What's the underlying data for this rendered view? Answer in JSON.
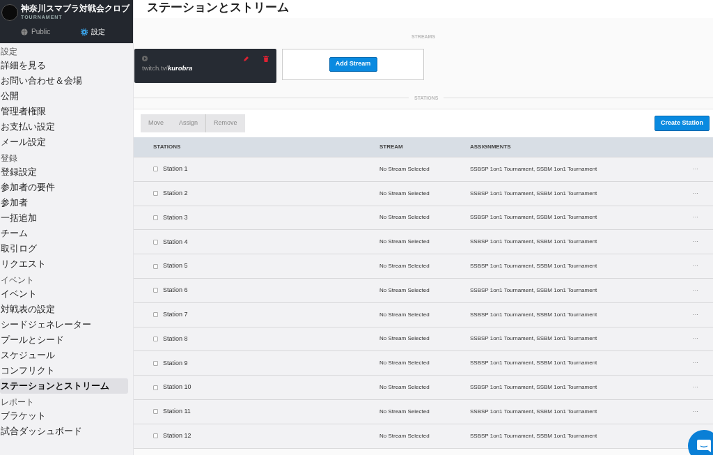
{
  "sidebar": {
    "org_title": "神奈川スマブラ対戦会クロブ",
    "org_subtitle": "TOURNAMENT",
    "header_links": [
      {
        "label": "Public",
        "selected": false
      },
      {
        "label": "設定",
        "selected": true
      }
    ],
    "sections": [
      {
        "heading": "設定",
        "items": [
          {
            "label": "詳細を見る",
            "selected": false
          },
          {
            "label": "お問い合わせ＆会場",
            "selected": false
          },
          {
            "label": "公開",
            "selected": false
          },
          {
            "label": "管理者権限",
            "selected": false
          },
          {
            "label": "お支払い設定",
            "selected": false
          },
          {
            "label": "メール設定",
            "selected": false
          }
        ]
      },
      {
        "heading": "登録",
        "items": [
          {
            "label": "登録設定",
            "selected": false
          },
          {
            "label": "参加者の要件",
            "selected": false
          },
          {
            "label": "参加者",
            "selected": false
          },
          {
            "label": "一括追加",
            "selected": false
          },
          {
            "label": "チーム",
            "selected": false
          },
          {
            "label": "取引ログ",
            "selected": false
          },
          {
            "label": "リクエスト",
            "selected": false
          }
        ]
      },
      {
        "heading": "イベント",
        "items": [
          {
            "label": "イベント",
            "selected": false
          },
          {
            "label": "対戦表の設定",
            "selected": false
          },
          {
            "label": "シードジェネレーター",
            "selected": false
          },
          {
            "label": "プールとシード",
            "selected": false
          },
          {
            "label": "スケジュール",
            "selected": false
          },
          {
            "label": "コンフリクト",
            "selected": false
          },
          {
            "label": "ステーションとストリーム",
            "selected": true
          }
        ]
      },
      {
        "heading": "レポート",
        "items": [
          {
            "label": "ブラケット",
            "selected": false
          },
          {
            "label": "試合ダッシュボード",
            "selected": false
          }
        ]
      }
    ]
  },
  "page_title": "ステーションとストリーム",
  "streams_label": "STREAMS",
  "streams": [
    {
      "prefix": "twitch.tv/",
      "channel": "kurobra"
    }
  ],
  "add_stream_button": "Add Stream",
  "stations_label": "STATIONS",
  "toolbar": {
    "buttons": [
      {
        "label": "Move",
        "disabled": true
      },
      {
        "label": "Assign",
        "disabled": true
      },
      {
        "label": "Remove",
        "disabled": true
      }
    ],
    "create_button": "Create Station"
  },
  "table": {
    "columns": [
      "STATIONS",
      "STREAM",
      "ASSIGNMENTS"
    ],
    "rows": [
      {
        "name": "Station 1",
        "checked": false,
        "stream": "No Stream Selected",
        "assignments": "SSBSP 1on1 Tournament, SSBM 1on1 Tournament",
        "menu": "···"
      },
      {
        "name": "Station 2",
        "checked": false,
        "stream": "No Stream Selected",
        "assignments": "SSBSP 1on1 Tournament, SSBM 1on1 Tournament",
        "menu": "···"
      },
      {
        "name": "Station 3",
        "checked": false,
        "stream": "No Stream Selected",
        "assignments": "SSBSP 1on1 Tournament, SSBM 1on1 Tournament",
        "menu": "···"
      },
      {
        "name": "Station 4",
        "checked": false,
        "stream": "No Stream Selected",
        "assignments": "SSBSP 1on1 Tournament, SSBM 1on1 Tournament",
        "menu": "···"
      },
      {
        "name": "Station 5",
        "checked": false,
        "stream": "No Stream Selected",
        "assignments": "SSBSP 1on1 Tournament, SSBM 1on1 Tournament",
        "menu": "···"
      },
      {
        "name": "Station 6",
        "checked": false,
        "stream": "No Stream Selected",
        "assignments": "SSBSP 1on1 Tournament, SSBM 1on1 Tournament",
        "menu": "···"
      },
      {
        "name": "Station 7",
        "checked": false,
        "stream": "No Stream Selected",
        "assignments": "SSBSP 1on1 Tournament, SSBM 1on1 Tournament",
        "menu": "···"
      },
      {
        "name": "Station 8",
        "checked": false,
        "stream": "No Stream Selected",
        "assignments": "SSBSP 1on1 Tournament, SSBM 1on1 Tournament",
        "menu": "···"
      },
      {
        "name": "Station 9",
        "checked": false,
        "stream": "No Stream Selected",
        "assignments": "SSBSP 1on1 Tournament, SSBM 1on1 Tournament",
        "menu": "···"
      },
      {
        "name": "Station 10",
        "checked": false,
        "stream": "No Stream Selected",
        "assignments": "SSBSP 1on1 Tournament, SSBM 1on1 Tournament",
        "menu": "···"
      },
      {
        "name": "Station 11",
        "checked": false,
        "stream": "No Stream Selected",
        "assignments": "SSBSP 1on1 Tournament, SSBM 1on1 Tournament",
        "menu": "···"
      },
      {
        "name": "Station 12",
        "checked": false,
        "stream": "No Stream Selected",
        "assignments": "SSBSP 1on1 Tournament, SSBM 1on1 Tournament"
      }
    ]
  }
}
